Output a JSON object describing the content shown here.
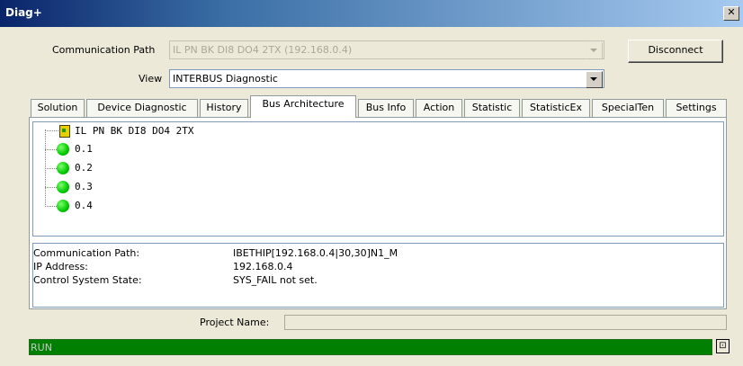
{
  "window": {
    "title": "Diag+"
  },
  "comm_path": {
    "label": "Communication Path",
    "value": "IL PN BK DI8 DO4 2TX (192.168.0.4)"
  },
  "disconnect_label": "Disconnect",
  "view": {
    "label": "View",
    "value": "INTERBUS Diagnostic"
  },
  "tabs": [
    {
      "label": "Solution"
    },
    {
      "label": "Device Diagnostic"
    },
    {
      "label": "History"
    },
    {
      "label": "Bus Architecture"
    },
    {
      "label": "Bus Info"
    },
    {
      "label": "Action"
    },
    {
      "label": "Statistic"
    },
    {
      "label": "StatisticEx"
    },
    {
      "label": "SpecialTen"
    },
    {
      "label": "Settings"
    }
  ],
  "active_tab": "Bus Architecture",
  "tree": {
    "root": "IL PN BK DI8 DO4 2TX",
    "children": [
      "0.1",
      "0.2",
      "0.3",
      "0.4"
    ]
  },
  "info": [
    {
      "key": "Communication Path:",
      "value": "IBETHIP[192.168.0.4|30,30]N1_M"
    },
    {
      "key": "IP Address:",
      "value": "192.168.0.4"
    },
    {
      "key": "Control System State:",
      "value": "SYS_FAIL not set."
    }
  ],
  "project_name": {
    "label": "Project Name:",
    "value": ""
  },
  "status": {
    "text": "RUN",
    "color": "#007f00"
  }
}
